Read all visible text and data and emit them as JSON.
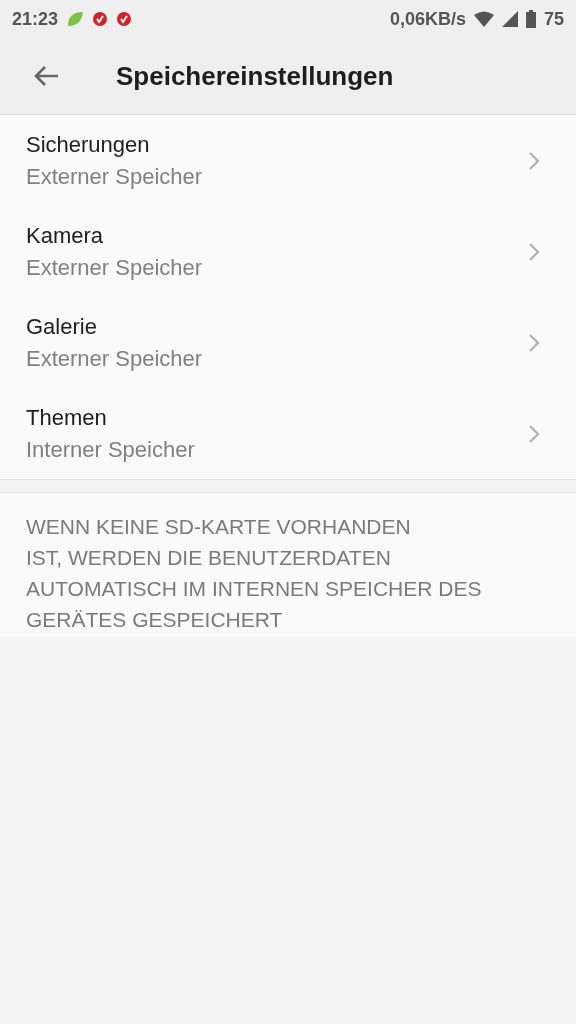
{
  "status_bar": {
    "time": "21:23",
    "speed": "0,06KB/s",
    "battery": "75"
  },
  "toolbar": {
    "title": "Speichereinstellungen"
  },
  "items": [
    {
      "title": "Sicherungen",
      "subtitle": "Externer Speicher"
    },
    {
      "title": "Kamera",
      "subtitle": "Externer Speicher"
    },
    {
      "title": "Galerie",
      "subtitle": "Externer Speicher"
    },
    {
      "title": "Themen",
      "subtitle": "Interner Speicher"
    }
  ],
  "note": [
    "WENN KEINE SD-KARTE VORHANDEN",
    "IST, WERDEN DIE BENUTZERDATEN",
    "AUTOMATISCH IM INTERNEN SPEICHER DES",
    "GERÄTES GESPEICHERT"
  ]
}
